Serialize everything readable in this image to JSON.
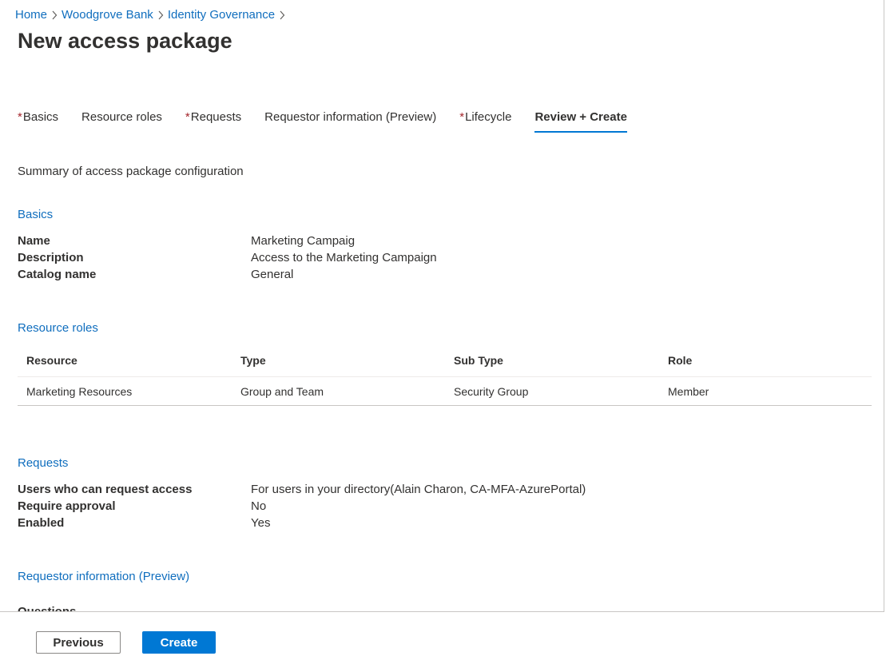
{
  "breadcrumb": [
    {
      "label": "Home"
    },
    {
      "label": "Woodgrove Bank"
    },
    {
      "label": "Identity Governance"
    }
  ],
  "page_title": "New access package",
  "tabs": [
    {
      "label": "Basics",
      "required": true
    },
    {
      "label": "Resource roles",
      "required": false
    },
    {
      "label": "Requests",
      "required": true
    },
    {
      "label": "Requestor information (Preview)",
      "required": false
    },
    {
      "label": "Lifecycle",
      "required": true
    },
    {
      "label": "Review + Create",
      "required": false,
      "active": true
    }
  ],
  "required_marker": "*",
  "summary_text": "Summary of access package configuration",
  "basics": {
    "heading": "Basics",
    "rows": [
      {
        "key": "Name",
        "value": "Marketing Campaig"
      },
      {
        "key": "Description",
        "value": "Access to the Marketing Campaign"
      },
      {
        "key": "Catalog name",
        "value": "General"
      }
    ]
  },
  "resource_roles": {
    "heading": "Resource roles",
    "columns": [
      "Resource",
      "Type",
      "Sub Type",
      "Role"
    ],
    "rows": [
      [
        "Marketing Resources",
        "Group and Team",
        "Security Group",
        "Member"
      ]
    ]
  },
  "requests": {
    "heading": "Requests",
    "rows": [
      {
        "key": "Users who can request access",
        "value": "For users in your directory(Alain Charon, CA-MFA-AzurePortal)"
      },
      {
        "key": "Require approval",
        "value": "No"
      },
      {
        "key": "Enabled",
        "value": "Yes"
      }
    ]
  },
  "requestor_info": {
    "heading": "Requestor information (Preview)",
    "cut_label": "Questions"
  },
  "footer": {
    "previous_label": "Previous",
    "create_label": "Create"
  },
  "colors": {
    "link": "#106ebe",
    "accent": "#0078d4",
    "required": "#a4262c",
    "text": "#323130"
  }
}
